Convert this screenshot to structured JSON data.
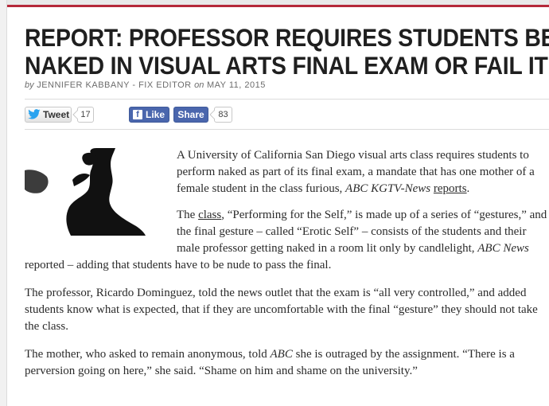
{
  "article": {
    "headline_line1": "REPORT: PROFESSOR REQUIRES STUDENTS BE",
    "headline_line2": "NAKED IN VISUAL ARTS FINAL EXAM OR FAIL IT",
    "byline_by": "by",
    "author": "JENNIFER KABBANY - FIX EDITOR",
    "byline_on": "on",
    "date": "MAY 11, 2015"
  },
  "share": {
    "tweet_label": "Tweet",
    "tweet_count": "17",
    "like_label": "Like",
    "share_label": "Share",
    "share_count": "83",
    "colors": {
      "facebook": "#4a66ad",
      "twitter_bird": "#2aa3ef"
    },
    "icons": [
      "twitter-bird-icon",
      "facebook-f-icon"
    ]
  },
  "image": {
    "description_icon": "silhouette-photo"
  },
  "paragraphs": {
    "p1_a": "A University of California San Diego visual arts class requires students to perform naked as part of its final exam, a mandate that has one mother of a female student in the class furious, ",
    "p1_source": "ABC KGTV-News",
    "p1_space": " ",
    "p1_link": "reports",
    "p1_end": ".",
    "p2_a": "The ",
    "p2_link": "class",
    "p2_b": ", “Performing for the Self,” is made up of a series of “gestures,” and the final gesture – called “Erotic Self” – consists of the students and their male professor getting naked in a room lit only by candlelight, ",
    "p2_source": "ABC News",
    "p2_c": " reported – adding that students have to be nude to pass the final.",
    "p3": "The professor, Ricardo Dominguez, told the news outlet that the exam is “all very controlled,” and added students know what is expected, that if they are uncomfortable with the final “gesture” they should not take the class.",
    "p4_a": "The mother, who asked to remain anonymous, told ",
    "p4_source": "ABC",
    "p4_b": " she is outraged by the assignment. “There is a perversion going on here,” she said. “Shame on him and shame on the university.”"
  }
}
